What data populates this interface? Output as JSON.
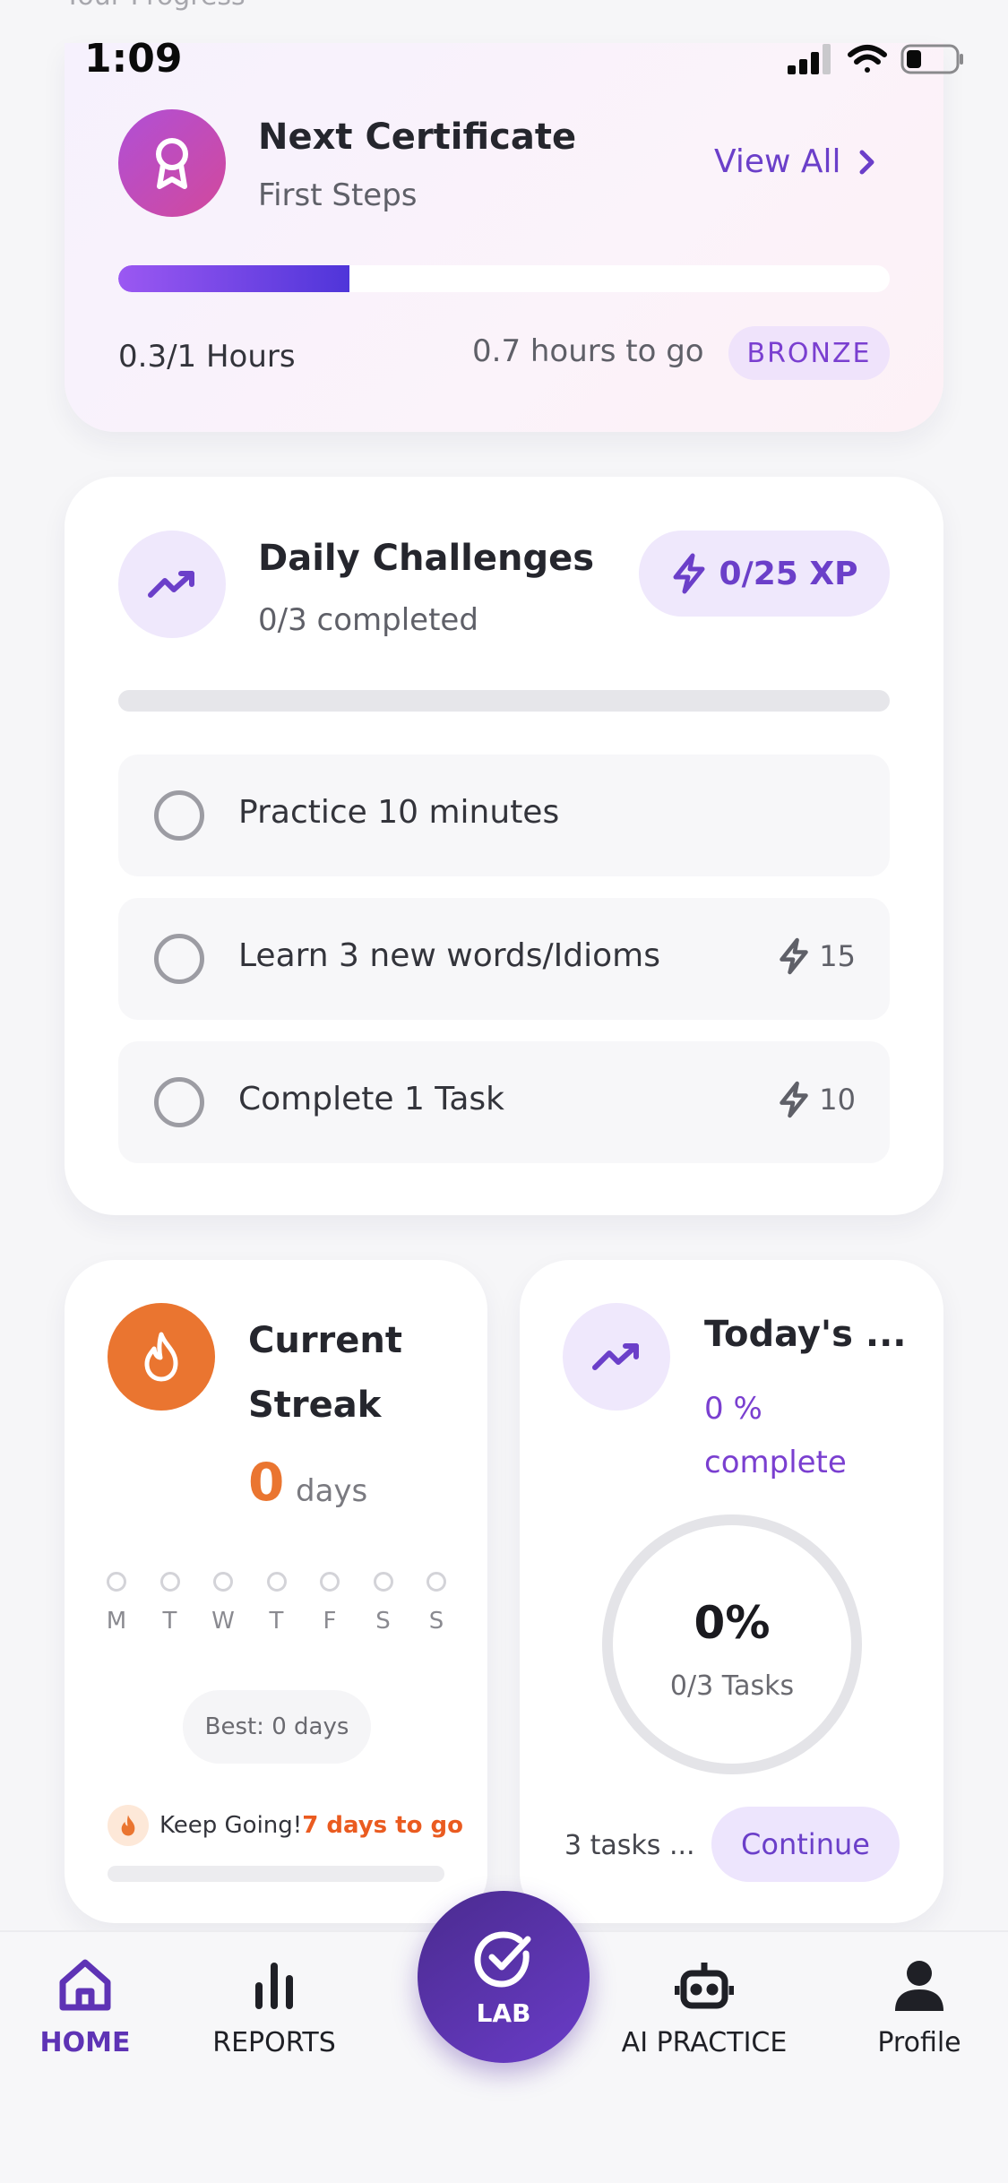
{
  "status_bar": {
    "peek_text": "Your Progress",
    "time": "1:09"
  },
  "certificate": {
    "title": "Next Certificate",
    "subtitle": "First Steps",
    "view_all": "View All",
    "progress": 0.3,
    "hours": "0.3/1 Hours",
    "to_go": "0.7 hours to go",
    "level": "BRONZE",
    "colors": {
      "badge_start": "#b04fd6",
      "badge_end": "#d2499c",
      "fill_start": "#9b58f2",
      "fill_end": "#4f35d9"
    }
  },
  "daily": {
    "title": "Daily Challenges",
    "subtitle": "0/3 completed",
    "xp": "0/25 XP",
    "progress": 0,
    "tasks": [
      {
        "label": "Practice 10 minutes",
        "xp": ""
      },
      {
        "label": "Learn 3 new words/Idioms",
        "xp": "15"
      },
      {
        "label": "Complete 1 Task",
        "xp": "10"
      }
    ]
  },
  "streak": {
    "title": "Current Streak",
    "count": "0",
    "unit": "days",
    "weekdays": [
      "M",
      "T",
      "W",
      "T",
      "F",
      "S",
      "S"
    ],
    "best": "Best: 0 days",
    "keep_going": "Keep Going!",
    "keep_highlight": "7 days to go",
    "accent": "#ea7530"
  },
  "today": {
    "title": "Today's ...",
    "subtitle": "0 % complete",
    "percent": "0%",
    "tasks": "0/3 Tasks",
    "footer": "3 tasks ...",
    "continue": "Continue"
  },
  "nav": {
    "home": "HOME",
    "reports": "REPORTS",
    "lab": "LAB",
    "ai_practice": "AI PRACTICE",
    "profile": "Profile",
    "active_color": "#5e33b5"
  }
}
